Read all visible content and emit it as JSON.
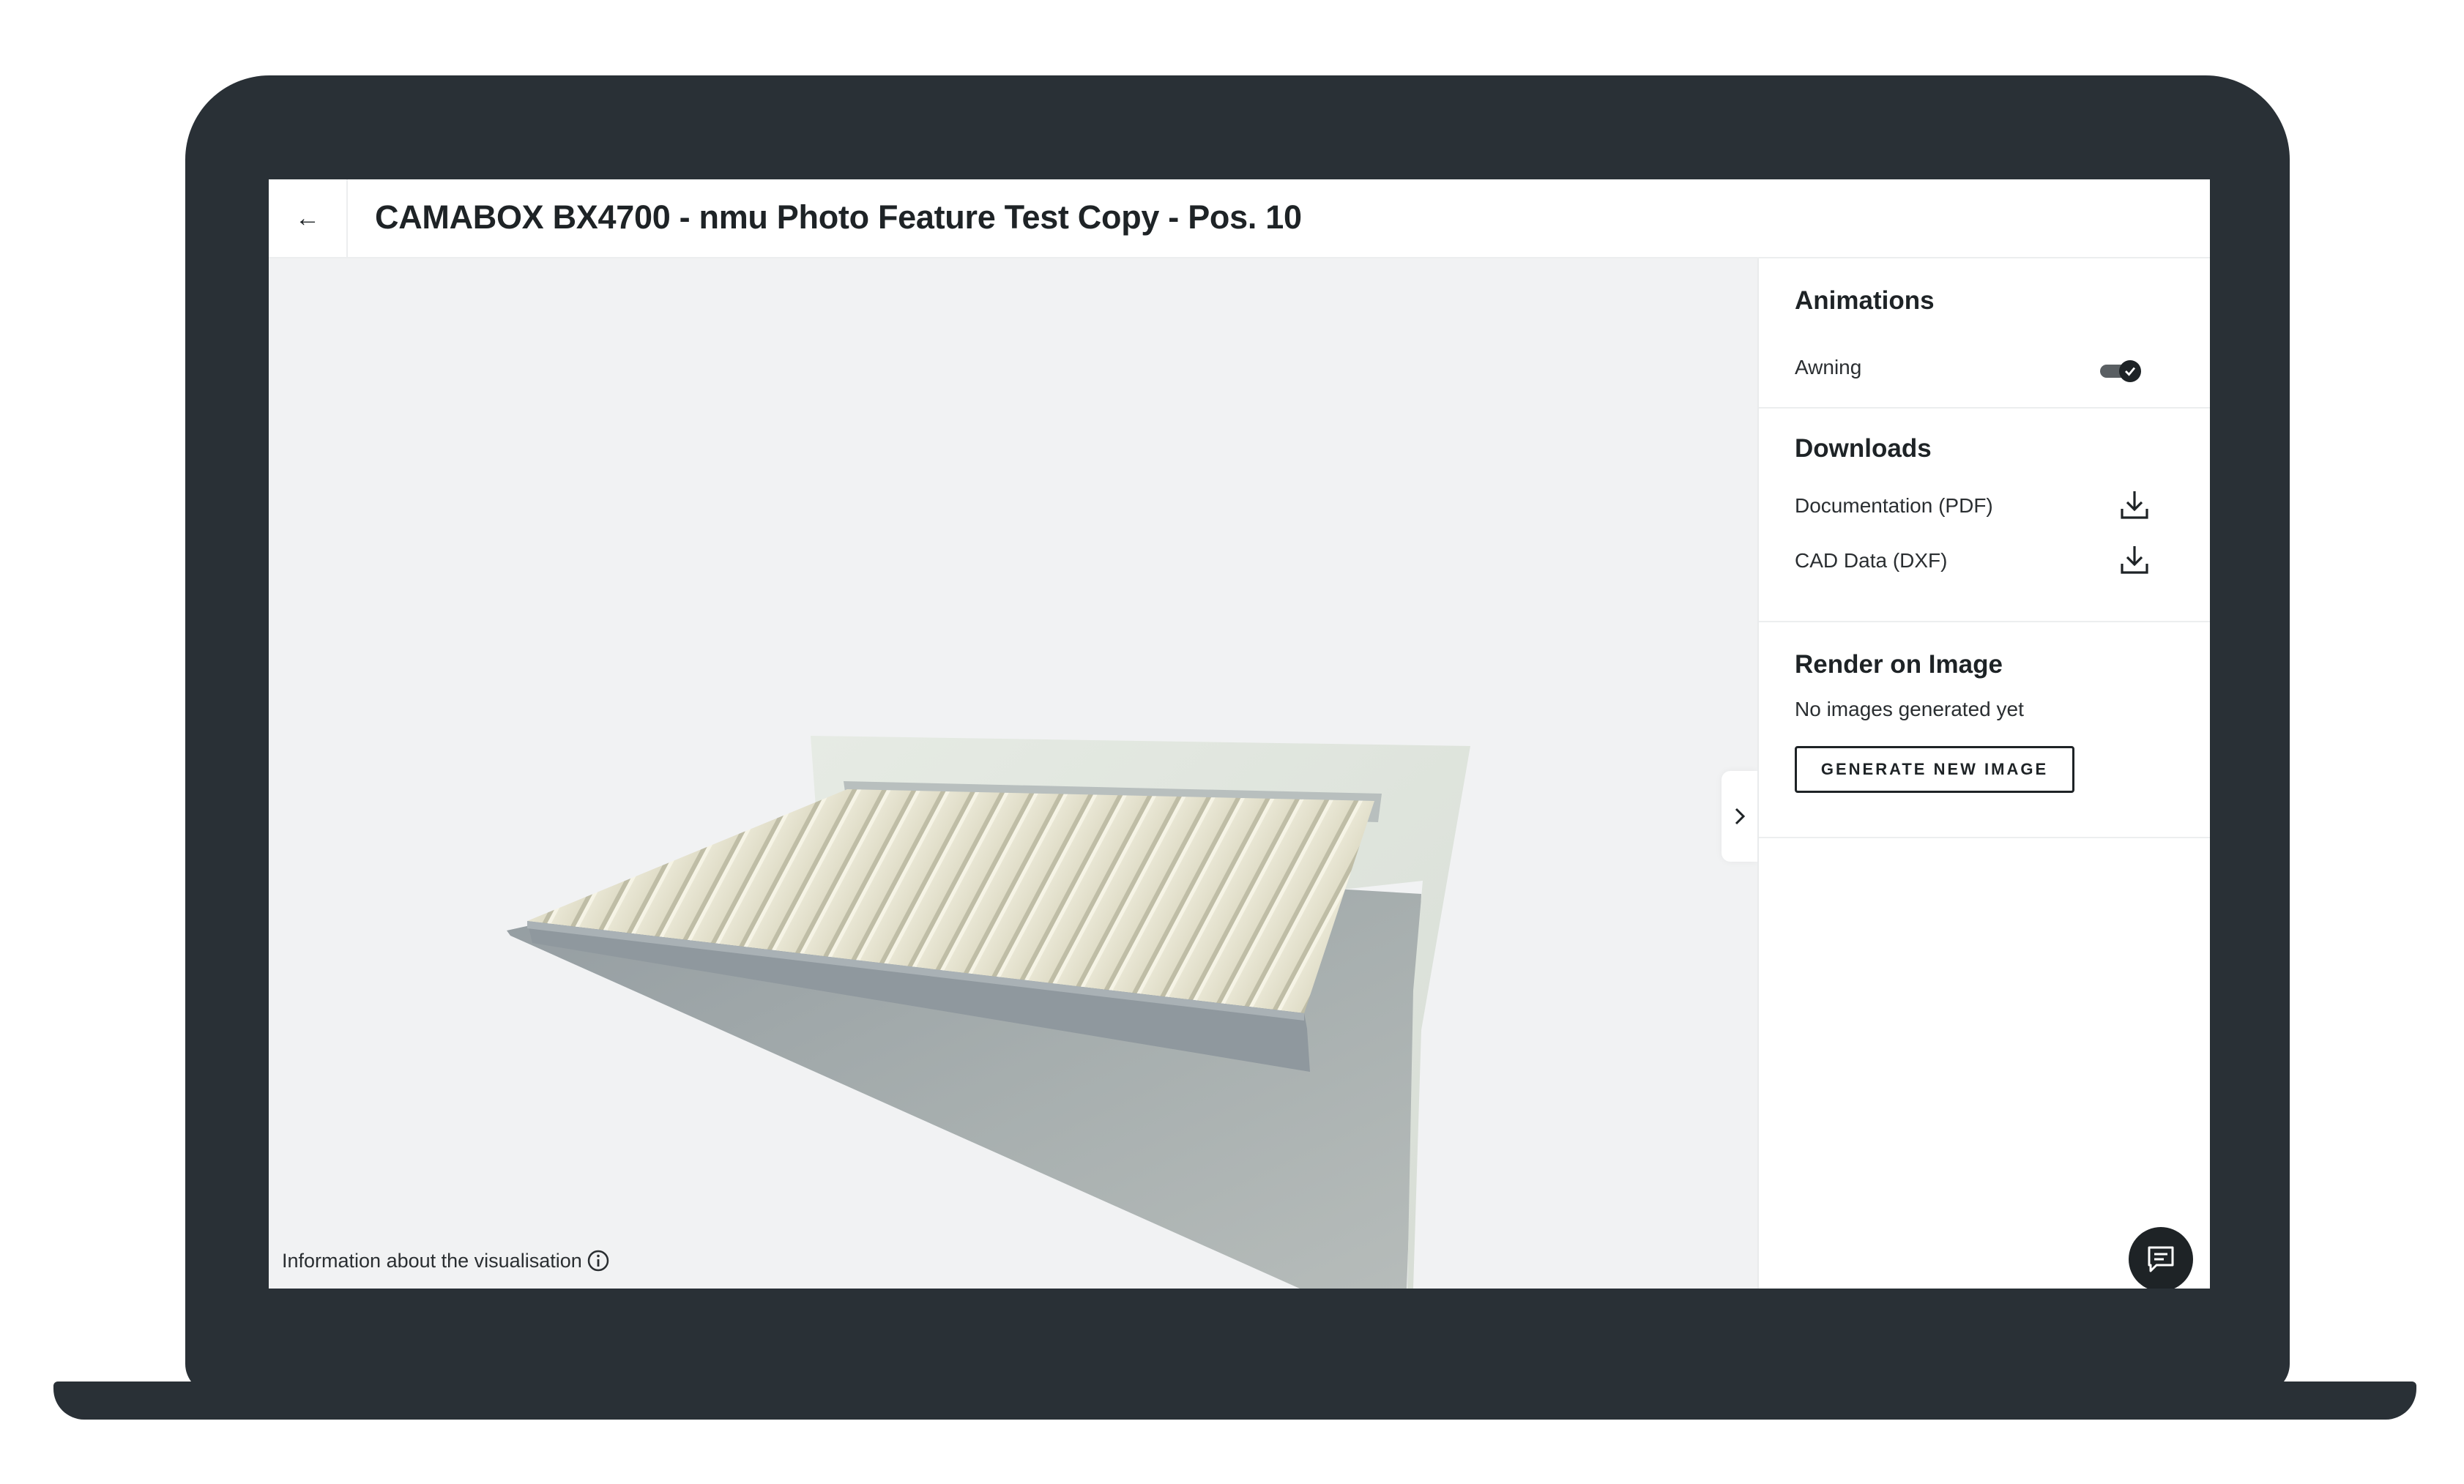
{
  "header": {
    "back_label": "←",
    "title": "CAMABOX BX4700 - nmu Photo Feature Test Copy - Pos. 10"
  },
  "viewer": {
    "info_label": "Information about the visualisation",
    "info_icon": "info-icon",
    "collapse_icon": "chevron-right-icon"
  },
  "panel": {
    "animations": {
      "title": "Animations",
      "items": [
        {
          "label": "Awning",
          "enabled": true
        }
      ]
    },
    "downloads": {
      "title": "Downloads",
      "items": [
        {
          "label": "Documentation (PDF)",
          "icon": "download-icon"
        },
        {
          "label": "CAD Data (DXF)",
          "icon": "download-icon"
        }
      ]
    },
    "render": {
      "title": "Render on Image",
      "status": "No images generated yet",
      "button_label": "GENERATE NEW IMAGE"
    }
  },
  "chat": {
    "icon": "chat-icon"
  },
  "colors": {
    "laptop_frame": "#293036",
    "viewer_background": "#f1f2f3",
    "text_primary": "#1e2326",
    "wall": "#dfe4de",
    "shadow": "#a0a6a6",
    "awning_fabric": "#e8e6d6",
    "awning_frame": "#8f989e"
  }
}
